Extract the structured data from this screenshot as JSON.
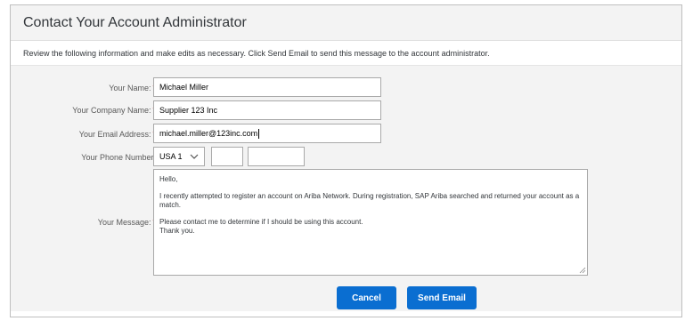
{
  "header": {
    "title": "Contact Your Account Administrator"
  },
  "instructions": "Review the following information and make edits as necessary. Click Send Email to send this message to the account administrator.",
  "form": {
    "name": {
      "label": "Your Name:",
      "required": "*",
      "value": "Michael Miller"
    },
    "company": {
      "label": "Your Company Name:",
      "required": "*",
      "value": "Supplier 123 Inc"
    },
    "email": {
      "label": "Your Email Address:",
      "required": "*",
      "value": "michael.miller@123inc.com"
    },
    "phone": {
      "label": "Your Phone Number:",
      "country": "USA 1",
      "area": "",
      "number": ""
    },
    "message": {
      "label": "Your Message:",
      "required": "*",
      "lines": [
        "Hello,",
        "I recently attempted to register an account on Ariba Network. During registration, SAP Ariba searched and returned your account as a match.",
        "Please contact me to determine if I should be using this account.",
        "Thank you."
      ]
    }
  },
  "buttons": {
    "cancel": "Cancel",
    "send": "Send Email"
  },
  "colors": {
    "primary_button": "#0a6ed1",
    "required_marker": "#c00000",
    "panel_bg": "#f3f3f3"
  },
  "icons": {
    "dropdown": "chevron-down-icon",
    "resize": "resize-grip-icon"
  }
}
